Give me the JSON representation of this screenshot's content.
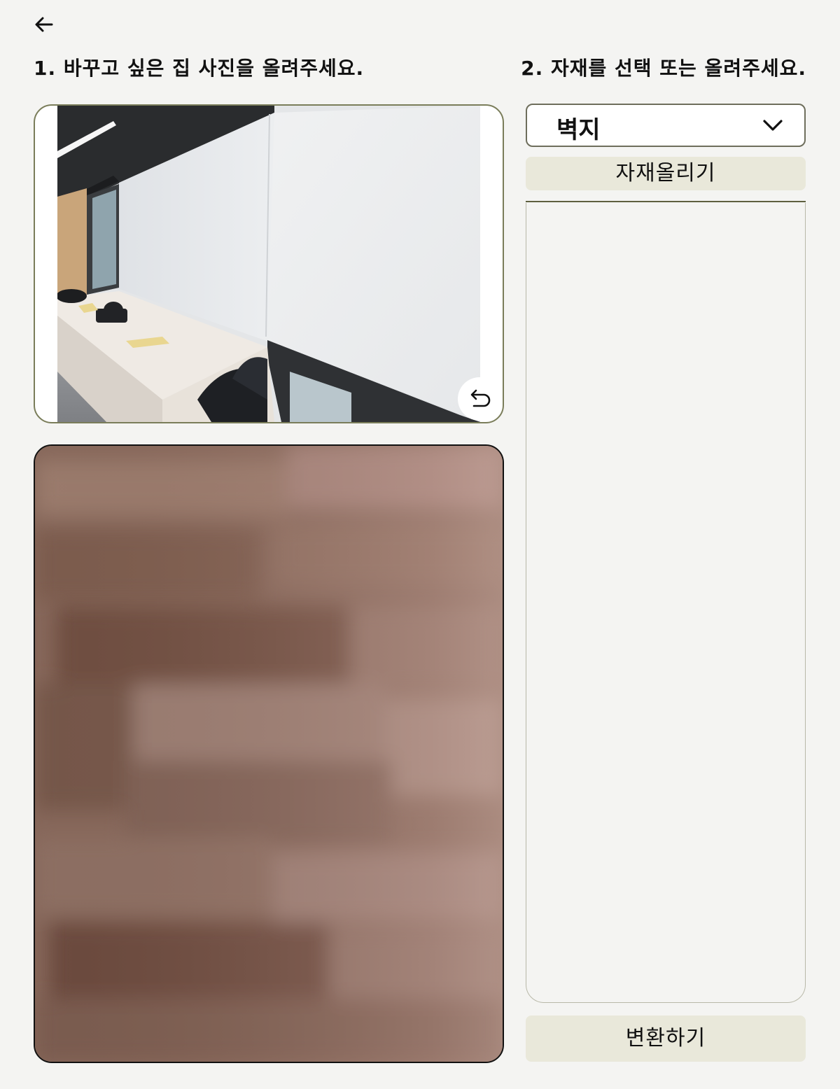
{
  "header": {
    "back_icon": "arrow-left-icon",
    "step1_title": "1. 바꾸고 싶은 집 사진을 올려주세요.",
    "step2_title": "2. 자재를 선택 또는 올려주세요."
  },
  "room_photo": {
    "undo_icon": "undo-icon"
  },
  "material": {
    "selected_category": "벽지",
    "dropdown_icon": "chevron-down-icon",
    "upload_label": "자재올리기",
    "items": []
  },
  "actions": {
    "convert_label": "변환하기"
  },
  "colors": {
    "background": "#f4f4f2",
    "button_bg": "#e9e8da",
    "frame_border": "#7a7d5a",
    "texture_base": "#8a6a5c"
  }
}
